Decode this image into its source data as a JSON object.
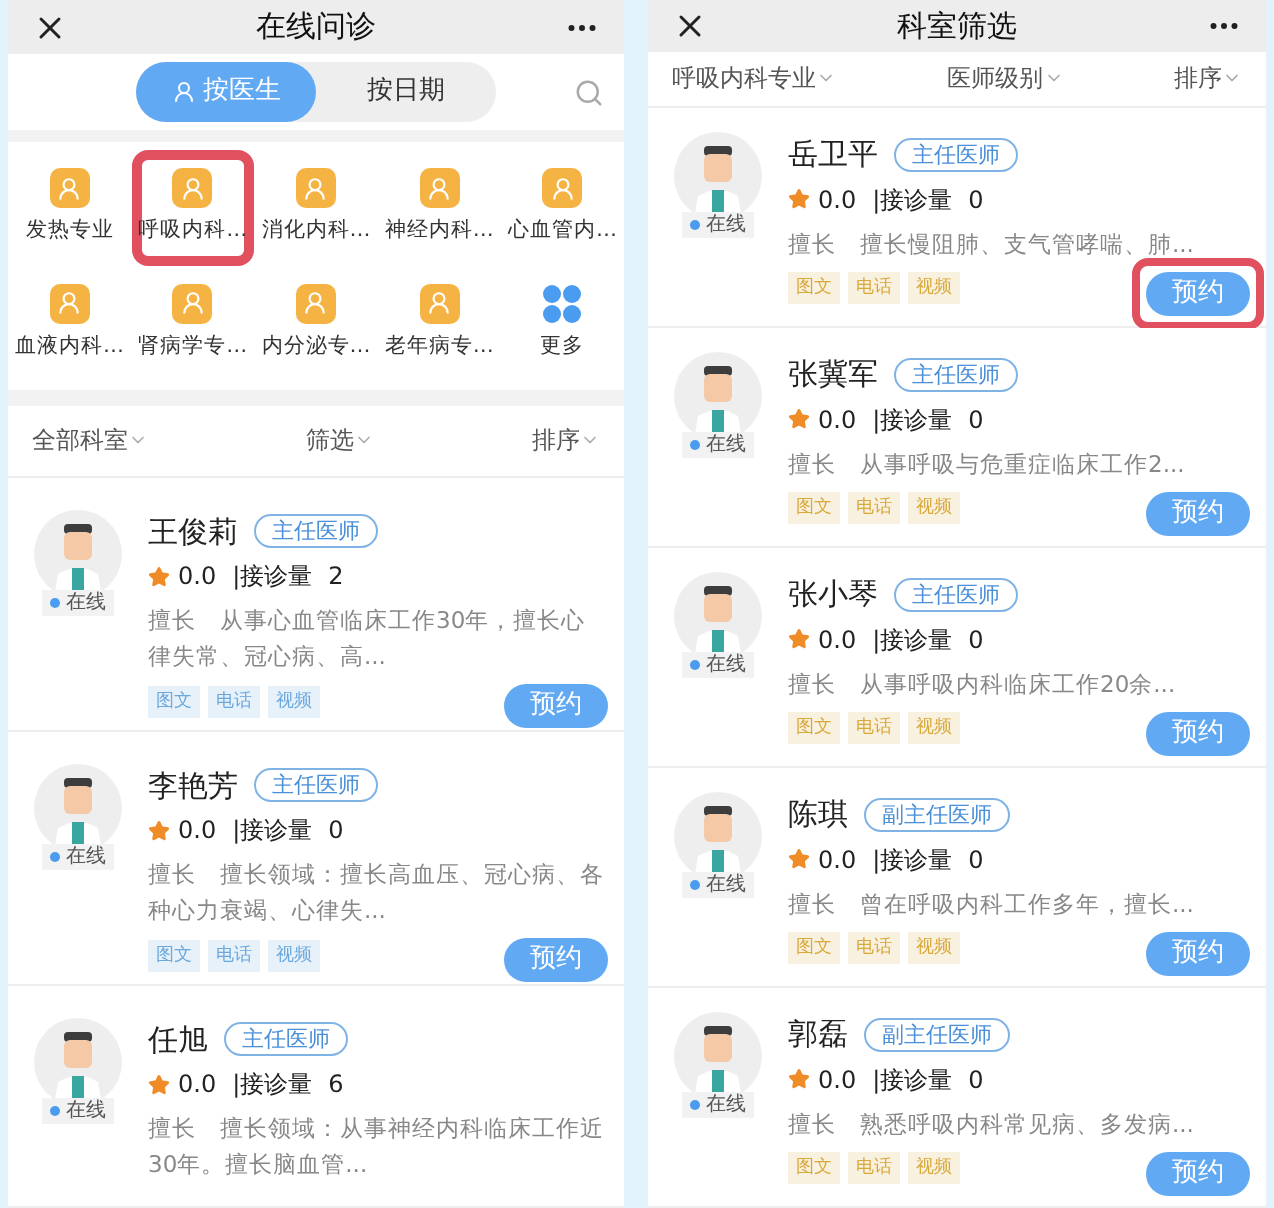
{
  "screens": [
    {
      "title": "在线问诊",
      "tabs": [
        {
          "label": "按医生",
          "selected": true
        },
        {
          "label": "按日期",
          "selected": false
        }
      ],
      "departments": [
        {
          "kind": "department",
          "label": "发热专业",
          "highlighted": false
        },
        {
          "kind": "department",
          "label": "呼吸内科…",
          "highlighted": true
        },
        {
          "kind": "department",
          "label": "消化内科…",
          "highlighted": false
        },
        {
          "kind": "department",
          "label": "神经内科…",
          "highlighted": false
        },
        {
          "kind": "department",
          "label": "心血管内…",
          "highlighted": false
        },
        {
          "kind": "department",
          "label": "血液内科…",
          "highlighted": false
        },
        {
          "kind": "department",
          "label": "肾病学专…",
          "highlighted": false
        },
        {
          "kind": "department",
          "label": "内分泌专…",
          "highlighted": false
        },
        {
          "kind": "department",
          "label": "老年病专…",
          "highlighted": false
        },
        {
          "kind": "more",
          "label": "更多",
          "highlighted": false
        }
      ],
      "filters": [
        "全部科室",
        "筛选",
        "排序"
      ],
      "doctors": [
        {
          "name": "王俊莉",
          "title": "主任医师",
          "status": "在线",
          "rating": "0.0",
          "visits_label": "|接诊量",
          "visits": "2",
          "specialty_label": "擅长",
          "specialty": "从事心血管临床工作30年，擅长心律失常、冠心病、高...",
          "services": [
            {
              "label": "图文",
              "color": "#6aa8de"
            },
            {
              "label": "电话",
              "color": "#6aa8de"
            },
            {
              "label": "视频",
              "color": "#6aa8de"
            }
          ],
          "action": "预约",
          "action_highlighted": false
        },
        {
          "name": "李艳芳",
          "title": "主任医师",
          "status": "在线",
          "rating": "0.0",
          "visits_label": "|接诊量",
          "visits": "0",
          "specialty_label": "擅长",
          "specialty": "擅长领域：擅长高血压、冠心病、各种心力衰竭、心律失...",
          "services": [
            {
              "label": "图文",
              "color": "#6aa8de"
            },
            {
              "label": "电话",
              "color": "#6aa8de"
            },
            {
              "label": "视频",
              "color": "#6aa8de"
            }
          ],
          "action": "预约",
          "action_highlighted": false
        },
        {
          "name": "任旭",
          "title": "主任医师",
          "status": "在线",
          "rating": "0.0",
          "visits_label": "|接诊量",
          "visits": "6",
          "specialty_label": "擅长",
          "specialty": "擅长领域：从事神经内科临床工作近30年。擅长脑血管..."
        }
      ]
    },
    {
      "title": "科室筛选",
      "filters": [
        "呼吸内科专业",
        "医师级别",
        "排序"
      ],
      "doctors": [
        {
          "name": "岳卫平",
          "title": "主任医师",
          "status": "在线",
          "rating": "0.0",
          "visits_label": "|接诊量",
          "visits": "0",
          "specialty_label": "擅长",
          "specialty": "擅长慢阻肺、支气管哮喘、肺...",
          "services": [
            {
              "label": "图文",
              "color": "#d9a83a"
            },
            {
              "label": "电话",
              "color": "#d9a83a"
            },
            {
              "label": "视频",
              "color": "#d9a83a"
            }
          ],
          "action": "预约",
          "action_highlighted": true
        },
        {
          "name": "张冀军",
          "title": "主任医师",
          "status": "在线",
          "rating": "0.0",
          "visits_label": "|接诊量",
          "visits": "0",
          "specialty_label": "擅长",
          "specialty": "从事呼吸与危重症临床工作2...",
          "services": [
            {
              "label": "图文",
              "color": "#d9a83a"
            },
            {
              "label": "电话",
              "color": "#d9a83a"
            },
            {
              "label": "视频",
              "color": "#d9a83a"
            }
          ],
          "action": "预约",
          "action_highlighted": false
        },
        {
          "name": "张小琴",
          "title": "主任医师",
          "status": "在线",
          "rating": "0.0",
          "visits_label": "|接诊量",
          "visits": "0",
          "specialty_label": "擅长",
          "specialty": "从事呼吸内科临床工作20余...",
          "services": [
            {
              "label": "图文",
              "color": "#d9a83a"
            },
            {
              "label": "电话",
              "color": "#d9a83a"
            },
            {
              "label": "视频",
              "color": "#d9a83a"
            }
          ],
          "action": "预约",
          "action_highlighted": false
        },
        {
          "name": "陈琪",
          "title": "副主任医师",
          "status": "在线",
          "rating": "0.0",
          "visits_label": "|接诊量",
          "visits": "0",
          "specialty_label": "擅长",
          "specialty": "曾在呼吸内科工作多年，擅长...",
          "services": [
            {
              "label": "图文",
              "color": "#d9a83a"
            },
            {
              "label": "电话",
              "color": "#d9a83a"
            },
            {
              "label": "视频",
              "color": "#d9a83a"
            }
          ],
          "action": "预约",
          "action_highlighted": false
        },
        {
          "name": "郭磊",
          "title": "副主任医师",
          "status": "在线",
          "rating": "0.0",
          "visits_label": "|接诊量",
          "visits": "0",
          "specialty_label": "擅长",
          "specialty": "熟悉呼吸内科常见病、多发病...",
          "services": [
            {
              "label": "图文",
              "color": "#d9a83a"
            },
            {
              "label": "电话",
              "color": "#d9a83a"
            },
            {
              "label": "视频",
              "color": "#d9a83a"
            }
          ],
          "action": "预约",
          "action_highlighted": false
        }
      ]
    }
  ]
}
